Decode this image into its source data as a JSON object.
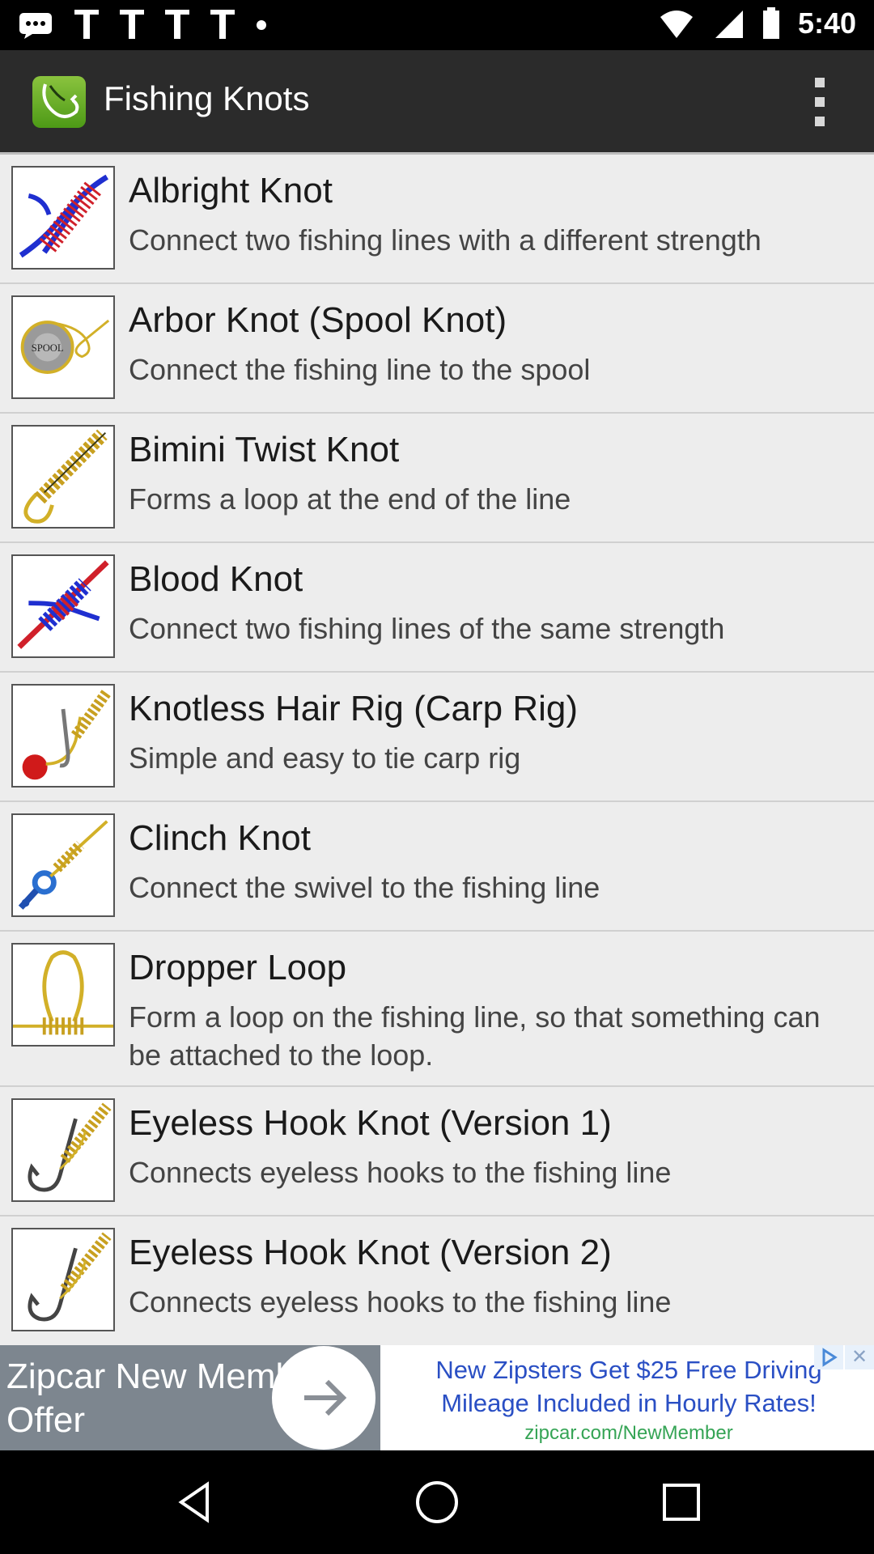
{
  "status_bar": {
    "time": "5:40",
    "notification_icons": [
      "message-icon",
      "notification-icon",
      "notification-icon",
      "notification-icon",
      "notification-icon",
      "more-dot-icon"
    ],
    "system_icons": [
      "wifi-icon",
      "signal-icon",
      "battery-icon"
    ]
  },
  "app_bar": {
    "title": "Fishing Knots",
    "logo_icon": "knot-app-logo-icon",
    "overflow_icon": "more-vert-icon"
  },
  "knots": [
    {
      "title": "Albright Knot",
      "description": "Connect two fishing lines with a different strength",
      "thumbnail": "albright-knot-icon"
    },
    {
      "title": "Arbor Knot (Spool Knot)",
      "description": "Connect the fishing line to the spool",
      "thumbnail": "arbor-knot-icon",
      "thumbnail_label": "SPOOL"
    },
    {
      "title": "Bimini Twist Knot",
      "description": "Forms a loop at the end of the line",
      "thumbnail": "bimini-twist-icon"
    },
    {
      "title": "Blood Knot",
      "description": "Connect two fishing lines of the same strength",
      "thumbnail": "blood-knot-icon"
    },
    {
      "title": "Knotless Hair Rig (Carp Rig)",
      "description": "Simple and easy to tie carp rig",
      "thumbnail": "hair-rig-icon"
    },
    {
      "title": "Clinch Knot",
      "description": "Connect the swivel to the fishing line",
      "thumbnail": "clinch-knot-icon"
    },
    {
      "title": "Dropper Loop",
      "description": "Form a loop on the fishing line, so that something can be attached to the loop.",
      "thumbnail": "dropper-loop-icon"
    },
    {
      "title": "Eyeless Hook Knot (Version 1)",
      "description": "Connects eyeless hooks to the fishing line",
      "thumbnail": "eyeless-hook-icon"
    },
    {
      "title": "Eyeless Hook Knot (Version 2)",
      "description": "Connects eyeless hooks to the fishing line",
      "thumbnail": "eyeless-hook-icon"
    }
  ],
  "ad": {
    "headline": "Zipcar New Member Offer",
    "body": "New Zipsters Get $25 Free Driving Mileage Included in Hourly Rates!",
    "url": "zipcar.com/NewMember",
    "adchoices_icon": "adchoices-icon",
    "close_icon": "close-icon"
  },
  "nav_bar": {
    "back_icon": "back-icon",
    "home_icon": "home-icon",
    "recents_icon": "recents-icon"
  },
  "colors": {
    "app_bar": "#2b2b2b",
    "list_background": "#ededed",
    "logo_green": "#6fb52c",
    "ad_panel": "#7d868f",
    "ad_text_blue": "#2a4fc4",
    "ad_url_green": "#35a455",
    "line_red": "#d0202a",
    "line_blue": "#1f2fd0",
    "line_gold": "#d2b028"
  }
}
